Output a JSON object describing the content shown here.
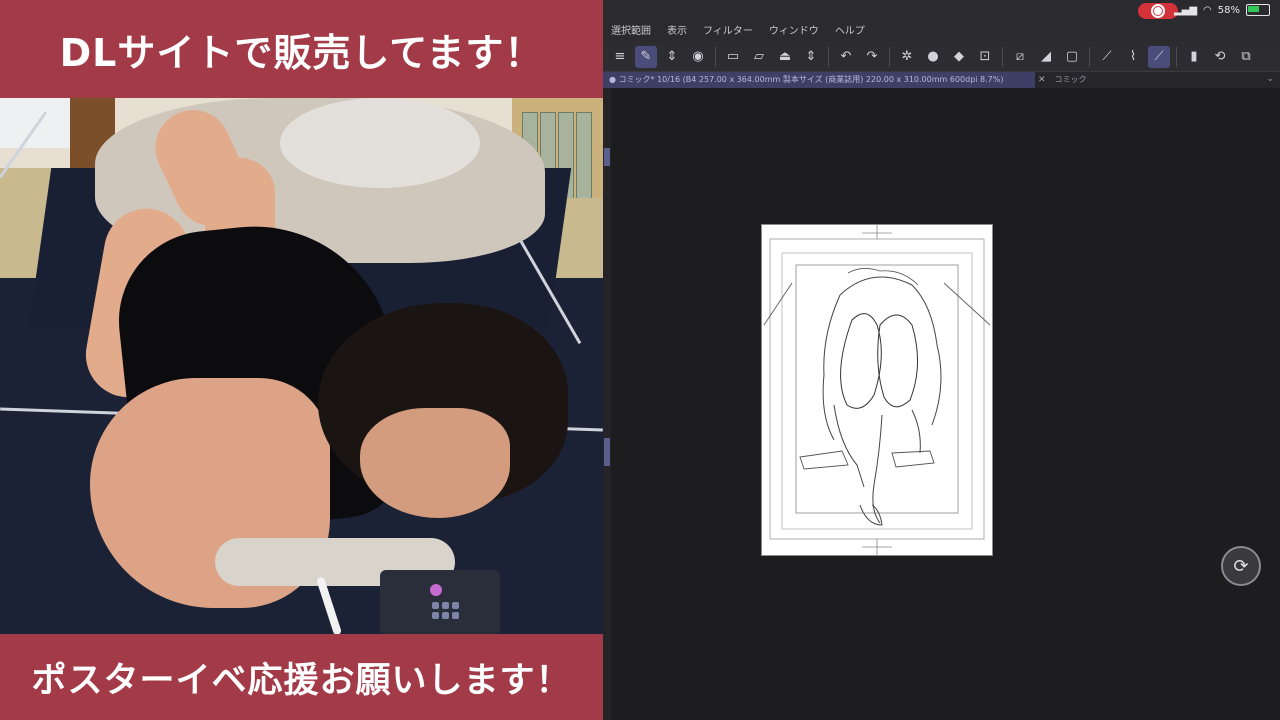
{
  "overlay": {
    "top_banner": "DLサイトで販売してます！",
    "bottom_banner": "ポスターイベ応援お願いします！",
    "banner_color": "#a33a48"
  },
  "status_bar": {
    "battery": "58%",
    "recording_color": "#d4313a"
  },
  "menu": {
    "items": [
      "選択範囲",
      "表示",
      "フィルター",
      "ウィンドウ",
      "ヘルプ"
    ]
  },
  "toolbar": {
    "tools": [
      "menu-icon",
      "pen-tool-icon",
      "stepper-icon",
      "layer-icon",
      "new-file-icon",
      "open-folder-icon",
      "save-icon",
      "undo-icon",
      "redo-icon",
      "settings-icon",
      "fill-icon",
      "transform-icon",
      "pen-icon",
      "brush-icon",
      "ruler-icon",
      "share-icon",
      "export-icon"
    ]
  },
  "tabs": {
    "active": "● コミック* 10/16 (B4 257.00 x 364.00mm 製本サイズ (商業誌用) 220.00 x 310.00mm 600dpi 8.7%)",
    "inactive": "コミック"
  },
  "canvas": {
    "accent_color": "#4a4c7a"
  }
}
